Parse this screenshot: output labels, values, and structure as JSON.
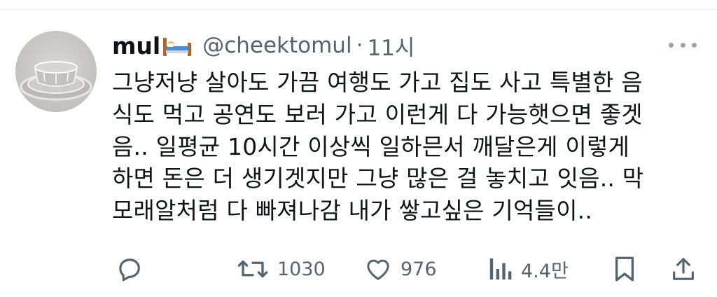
{
  "tweet": {
    "author": {
      "display_name": "mul",
      "name_emoji": "bed-emoji",
      "handle": "@cheektomul",
      "separator": "·",
      "time": "11시"
    },
    "text": "그냥저냥 살아도 가끔 여행도 가고 집도 사고 특별한 음\n식도 먹고 공연도 보러 가고 이런게 다 가능햇으면 좋겟\n음.. 일평균 10시간 이상씩 일하믄서 깨달은게 이렇게\n하면 돈은 더 생기겟지만 그냥 많은 걸 놓치고 잇음.. 막\n모래알처럼 다 빠져나감 내가 쌓고싶은 기억들이..",
    "actions": {
      "reply": {
        "icon": "reply-icon"
      },
      "retweet": {
        "icon": "retweet-icon",
        "count": "1030"
      },
      "like": {
        "icon": "heart-icon",
        "count": "976"
      },
      "views": {
        "icon": "views-icon",
        "count": "4.4만"
      },
      "bookmark": {
        "icon": "bookmark-icon"
      },
      "share": {
        "icon": "share-icon"
      }
    }
  },
  "colors": {
    "text": "#0f1419",
    "secondary": "#536471",
    "divider": "#eff3f4"
  }
}
